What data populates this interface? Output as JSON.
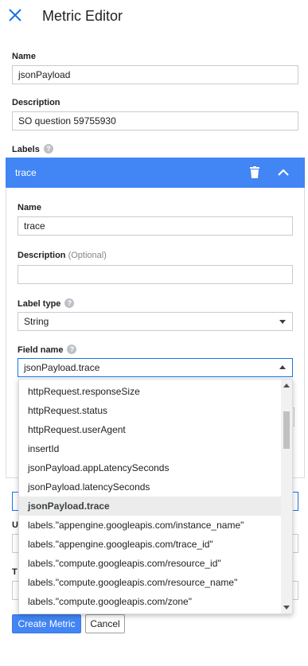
{
  "header": {
    "title": "Metric Editor",
    "close_icon": "close-icon"
  },
  "form": {
    "name": {
      "label": "Name",
      "value": "jsonPayload"
    },
    "description": {
      "label": "Description",
      "value": "SO question 59755930"
    },
    "labels": {
      "label": "Labels",
      "help_icon": "help-icon"
    }
  },
  "label_panel": {
    "title": "trace",
    "accent_color": "#4285f4",
    "name": {
      "label": "Name",
      "value": "trace"
    },
    "description": {
      "label": "Description",
      "optional": "(Optional)",
      "value": ""
    },
    "label_type": {
      "label": "Label type",
      "value": "String"
    },
    "field_name": {
      "label": "Field name",
      "value": "jsonPayload.trace",
      "options": [
        {
          "label": "httpRequest.responseSize"
        },
        {
          "label": "httpRequest.status"
        },
        {
          "label": "httpRequest.userAgent"
        },
        {
          "label": "insertId"
        },
        {
          "label": "jsonPayload.appLatencySeconds"
        },
        {
          "label": "jsonPayload.latencySeconds"
        },
        {
          "label": "jsonPayload.trace",
          "selected": true
        },
        {
          "label": "labels.\"appengine.googleapis.com/instance_name\""
        },
        {
          "label": "labels.\"appengine.googleapis.com/trace_id\""
        },
        {
          "label": "labels.\"compute.googleapis.com/resource_id\""
        },
        {
          "label": "labels.\"compute.googleapis.com/resource_name\""
        },
        {
          "label": "labels.\"compute.googleapis.com/zone\""
        }
      ]
    }
  },
  "obscured": {
    "letter_1": "U",
    "letter_2": "T"
  },
  "actions": {
    "create": "Create Metric",
    "cancel": "Cancel"
  }
}
